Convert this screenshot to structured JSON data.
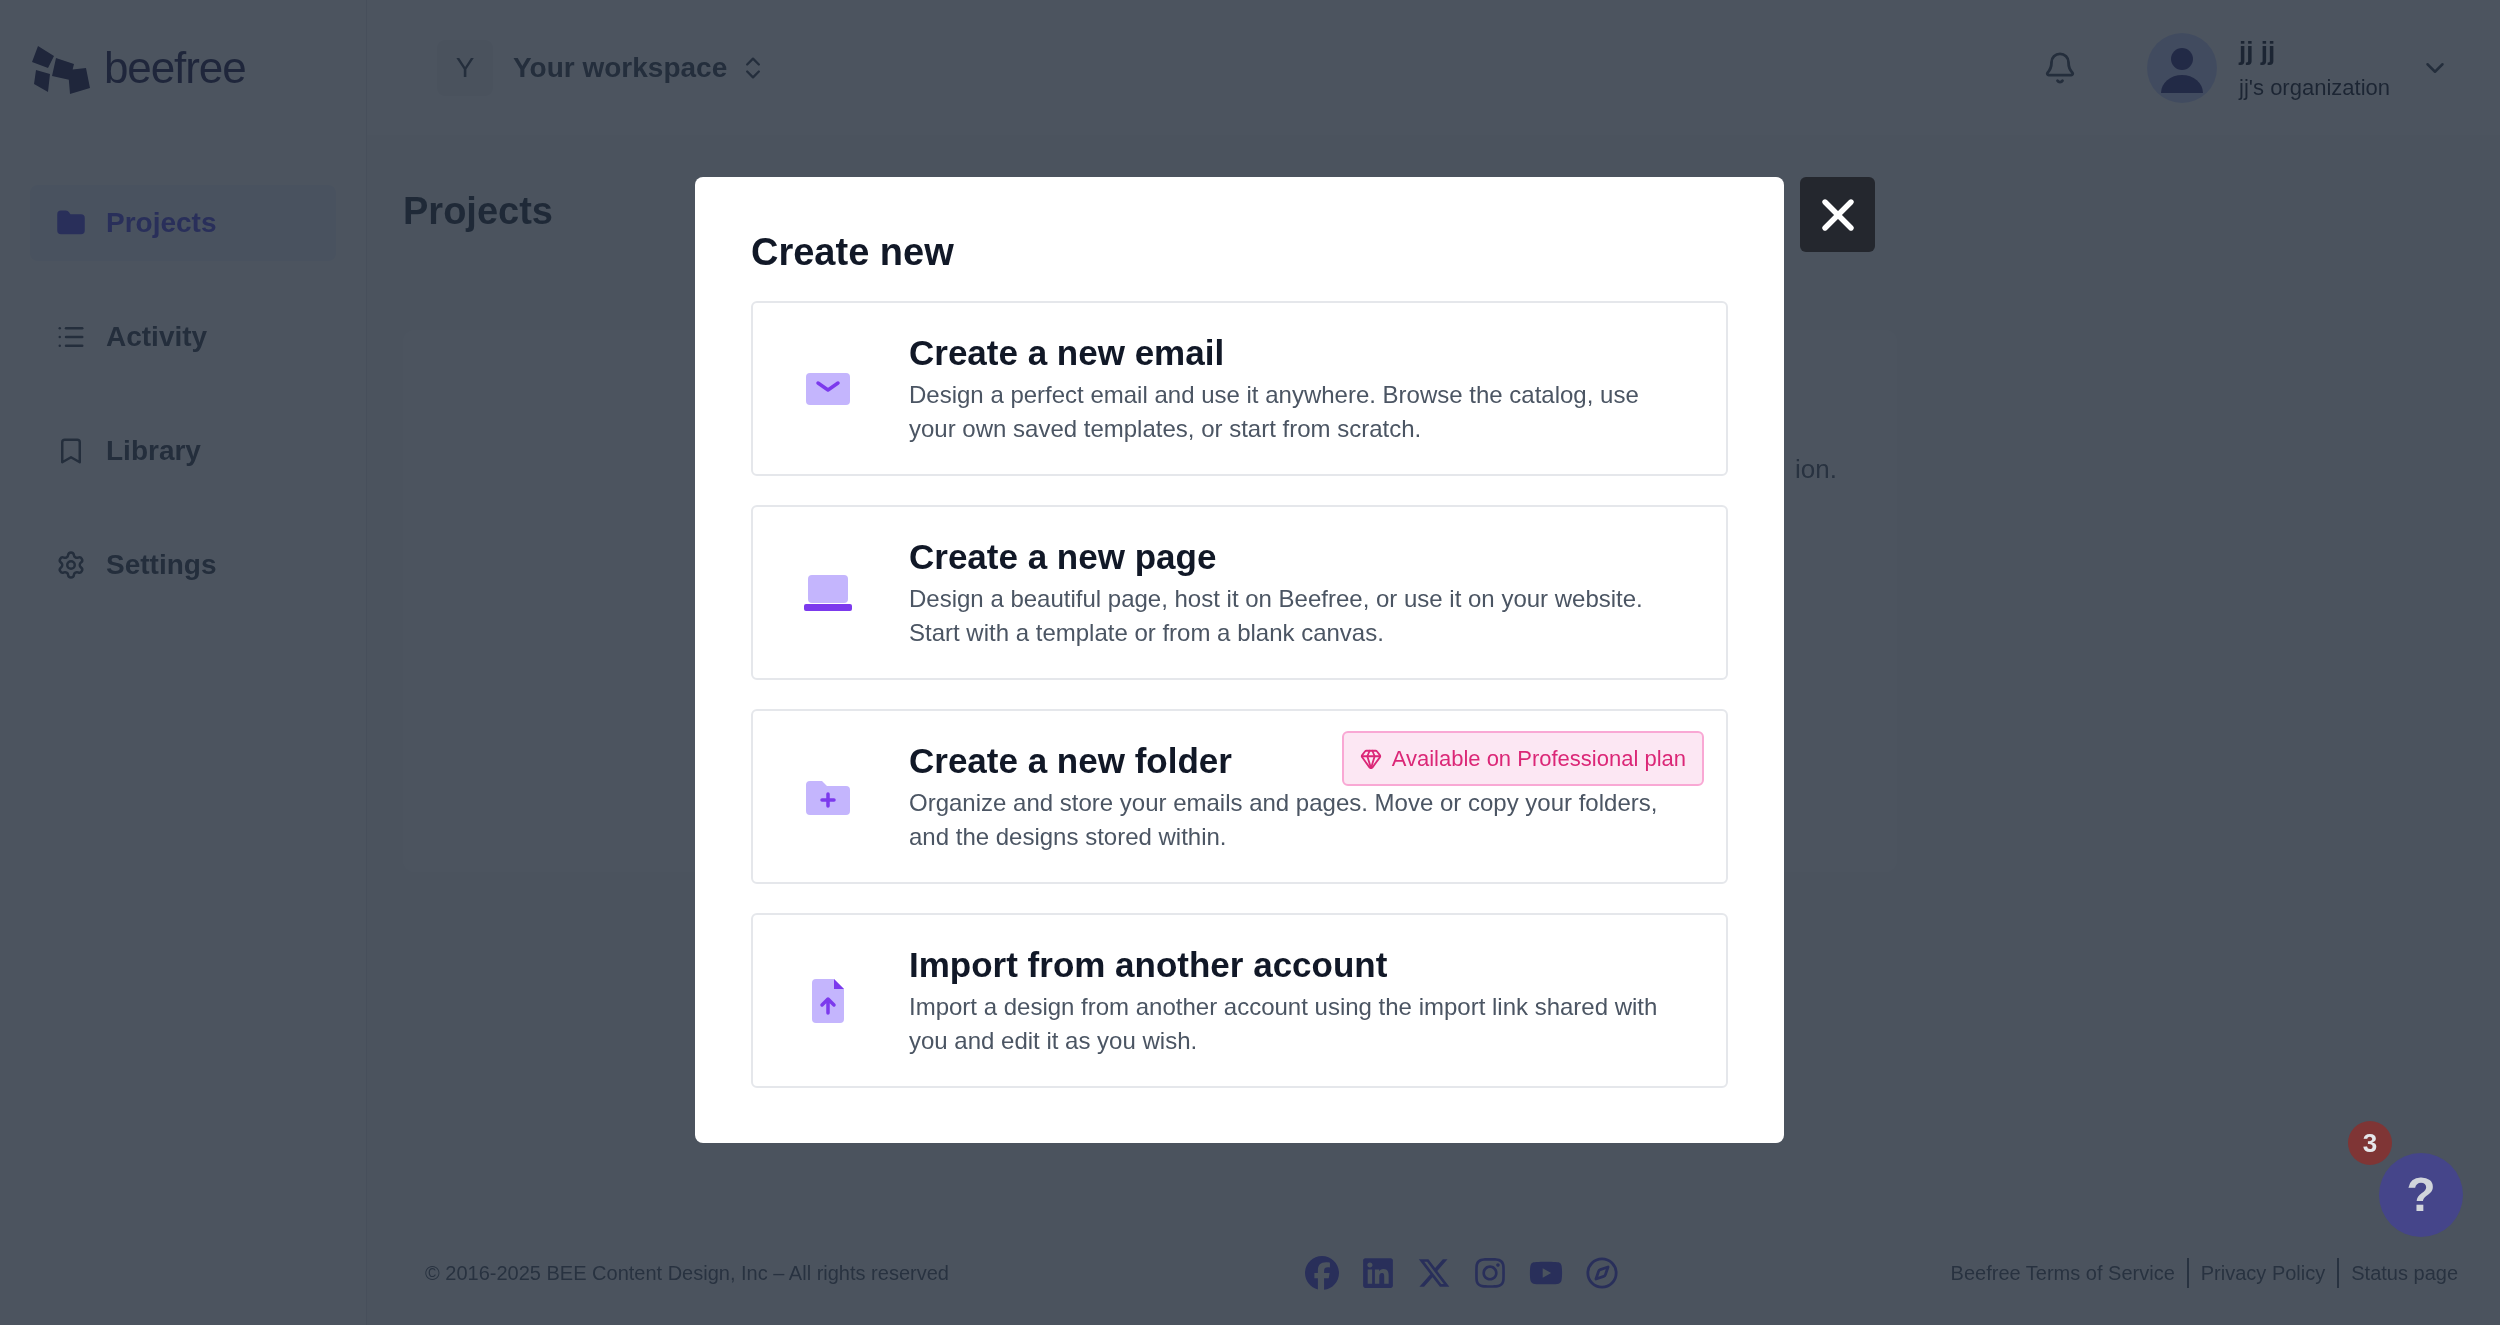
{
  "brand": {
    "name": "beefree"
  },
  "workspace": {
    "initial": "Y",
    "name": "Your workspace"
  },
  "user": {
    "name": "jj jj",
    "organization": "jj's organization"
  },
  "sidebar": {
    "items": [
      {
        "kind": "folder",
        "label": "Projects",
        "selected": true
      },
      {
        "kind": "list",
        "label": "Activity",
        "selected": false
      },
      {
        "kind": "bookmark",
        "label": "Library",
        "selected": false
      },
      {
        "kind": "gear",
        "label": "Settings",
        "selected": false
      }
    ]
  },
  "page": {
    "title": "Projects",
    "card_text": "ion."
  },
  "modal": {
    "title": "Create new",
    "options": [
      {
        "kind": "email",
        "title": "Create a new email",
        "description": "Design a perfect email and use it anywhere. Browse the catalog, use your own saved templates, or start from scratch."
      },
      {
        "kind": "page",
        "title": "Create a new page",
        "description": "Design a beautiful page, host it on Beefree, or use it on your website. Start with a template or from a blank canvas."
      },
      {
        "kind": "folder",
        "title": "Create a new folder",
        "description": "Organize and store your emails and pages. Move or copy your folders, and the designs stored within.",
        "badge": "Available on Professional plan"
      },
      {
        "kind": "import",
        "title": "Import from another account",
        "description": "Import a design from another account using the import link shared with you and edit it as you wish."
      }
    ]
  },
  "footer": {
    "copyright": "© 2016-2025 BEE Content Design, Inc – All rights reserved",
    "links": [
      "Beefree Terms of Service",
      "Privacy Policy",
      "Status page"
    ]
  },
  "help": {
    "count": "3",
    "label": "?"
  }
}
